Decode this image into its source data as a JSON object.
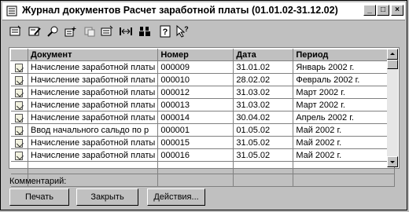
{
  "window": {
    "title": "Журнал документов  Расчет заработной платы (01.01.02-31.12.02)",
    "controls": [
      "minimize-icon",
      "maximize-icon",
      "close-icon"
    ]
  },
  "toolbar": {
    "icons": [
      "new-document-icon",
      "edit-document-icon",
      "find-icon",
      "copy-document-icon",
      "move-icon",
      "filter-icon",
      "interval-icon",
      "tree-icon",
      "help-icon",
      "context-help-icon"
    ]
  },
  "table": {
    "columns": [
      "",
      "Документ",
      "Номер",
      "Дата",
      "Период"
    ],
    "rows": [
      {
        "doc": "Начисление заработной платы",
        "num": "000009",
        "date": "31.01.02",
        "period": "Январь 2002 г."
      },
      {
        "doc": "Начисление заработной платы",
        "num": "000010",
        "date": "28.02.02",
        "period": "Февраль 2002 г."
      },
      {
        "doc": "Начисление заработной платы",
        "num": "000012",
        "date": "31.03.02",
        "period": "Март 2002 г."
      },
      {
        "doc": "Начисление заработной платы",
        "num": "000013",
        "date": "31.03.02",
        "period": "Март 2002 г."
      },
      {
        "doc": "Начисление заработной платы",
        "num": "000014",
        "date": "30.04.02",
        "period": "Апрель 2002 г."
      },
      {
        "doc": "Ввод начального сальдо по р",
        "num": "000001",
        "date": "01.05.02",
        "period": "Май 2002 г."
      },
      {
        "doc": "Начисление заработной платы",
        "num": "000015",
        "date": "31.05.02",
        "period": "Май 2002 г."
      },
      {
        "doc": "Начисление заработной платы",
        "num": "000016",
        "date": "31.05.02",
        "period": "Май 2002 г."
      }
    ]
  },
  "comment_label": "Комментарий:",
  "buttons": {
    "print": "Печать",
    "close": "Закрыть",
    "actions": "Действия..."
  }
}
